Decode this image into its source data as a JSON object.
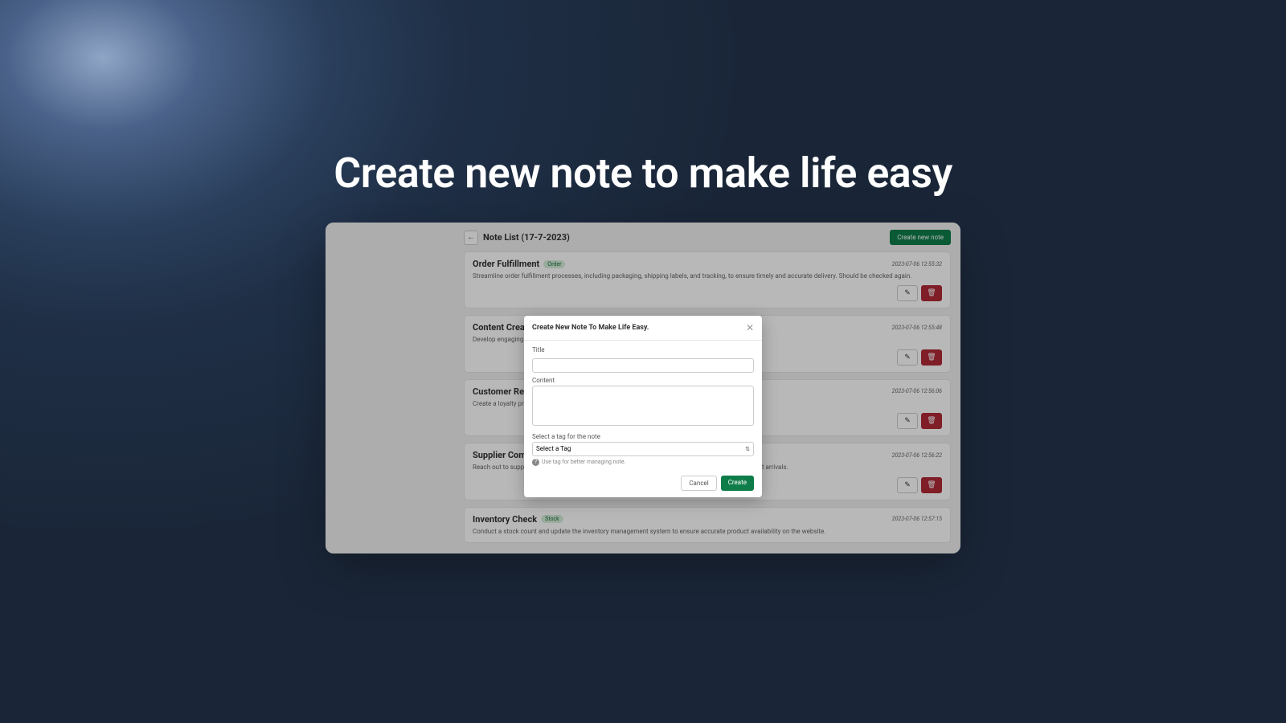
{
  "hero": {
    "title": "Create new note to make life easy"
  },
  "header": {
    "back_icon": "←",
    "title": "Note List (17-7-2023)",
    "create_button": "Create new note"
  },
  "notes": [
    {
      "title": "Order Fulfillment",
      "tag": "Order",
      "date": "2023-07-06 12:55:32",
      "desc": "Streamline order fulfillment processes, including packaging, shipping labels, and tracking, to ensure timely and accurate delivery. Should be checked again."
    },
    {
      "title": "Content Crea",
      "tag": "",
      "date": "2023-07-06 12:55:48",
      "desc": "Develop engaging t"
    },
    {
      "title": "Customer Re",
      "tag": "",
      "date": "2023-07-06 12:56:06",
      "desc": "Create a loyalty pro"
    },
    {
      "title": "Supplier Com",
      "tag": "",
      "date": "2023-07-06 12:56:22",
      "desc": "Reach out to suppliers to discuss potential discounts, negotiate pricing, and inquire about new product arrivals."
    },
    {
      "title": "Inventory Check",
      "tag": "Stock",
      "date": "2023-07-06 12:57:15",
      "desc": "Conduct a stock count and update the inventory management system to ensure accurate product availability on the website."
    }
  ],
  "icons": {
    "edit": "✎",
    "delete": "🗑",
    "select_caret": "⇅"
  },
  "modal": {
    "title": "Create New Note To Make Life Easy.",
    "close": "✕",
    "title_label": "Title",
    "content_label": "Content",
    "tag_label": "Select a tag for the note",
    "tag_placeholder": "Select a Tag",
    "help_icon": "?",
    "help_text": "Use tag for better managing note.",
    "cancel": "Cancel",
    "create": "Create"
  }
}
